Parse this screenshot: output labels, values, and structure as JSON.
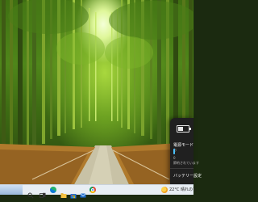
{
  "wallpaper": {
    "description_icon": "bamboo-forest-wallpaper"
  },
  "flyout": {
    "power_mode_label": "電源モード",
    "power_mode_sub": "お",
    "slider_value_label": "0",
    "battery_saver_sub": "節約されています",
    "battery_settings_label": "バッテリー設定"
  },
  "taskbar": {
    "icons": [
      "windows-start-icon",
      "search-icon",
      "task-view-icon",
      "edge-icon",
      "file-explorer-icon",
      "store-icon",
      "mail-icon",
      "chrome-icon"
    ],
    "weather_text": "22°C  晴れのち"
  },
  "colors": {
    "accent": "#4cc2ff",
    "flyout_bg": "#202020",
    "taskbar_bg": "#e8eef4"
  }
}
